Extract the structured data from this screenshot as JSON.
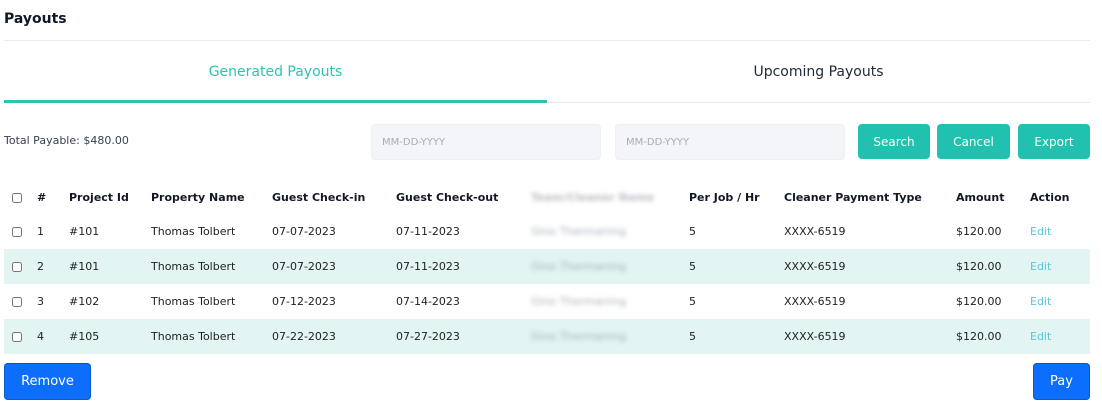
{
  "page": {
    "title": "Payouts"
  },
  "tabs": [
    {
      "label": "Generated Payouts",
      "active": true
    },
    {
      "label": "Upcoming Payouts",
      "active": false
    }
  ],
  "filters": {
    "total_payable": "Total Payable: $480.00",
    "start_date_placeholder": "MM-DD-YYYY",
    "end_date_placeholder": "MM-DD-YYYY",
    "search_label": "Search",
    "cancel_label": "Cancel",
    "export_label": "Export"
  },
  "table": {
    "headers": [
      "#",
      "Project Id",
      "Property Name",
      "Guest Check-in",
      "Guest Check-out",
      "Team/Cleaner Name",
      "Per Job / Hr",
      "Cleaner Payment Type",
      "Amount",
      "Action"
    ],
    "rows": [
      {
        "num": "1",
        "project_id": "#101",
        "property": "Thomas Tolbert",
        "checkin": "07-07-2023",
        "checkout": "07-11-2023",
        "team": "Gino Thermaning",
        "per_job": "5",
        "payment_type": "XXXX-6519",
        "amount": "$120.00",
        "action": "Edit"
      },
      {
        "num": "2",
        "project_id": "#101",
        "property": "Thomas Tolbert",
        "checkin": "07-07-2023",
        "checkout": "07-11-2023",
        "team": "Gino Thermaning",
        "per_job": "5",
        "payment_type": "XXXX-6519",
        "amount": "$120.00",
        "action": "Edit"
      },
      {
        "num": "3",
        "project_id": "#102",
        "property": "Thomas Tolbert",
        "checkin": "07-12-2023",
        "checkout": "07-14-2023",
        "team": "Gino Thermaning",
        "per_job": "5",
        "payment_type": "XXXX-6519",
        "amount": "$120.00",
        "action": "Edit"
      },
      {
        "num": "4",
        "project_id": "#105",
        "property": "Thomas Tolbert",
        "checkin": "07-22-2023",
        "checkout": "07-27-2023",
        "team": "Gino Thermaning",
        "per_job": "5",
        "payment_type": "XXXX-6519",
        "amount": "$120.00",
        "action": "Edit"
      }
    ]
  },
  "footer": {
    "remove_label": "Remove",
    "pay_label": "Pay"
  },
  "colors": {
    "accent": "#20c1ae",
    "primary": "#0d6efd",
    "row_alt": "#e2f5f2",
    "link": "#58c7d6"
  }
}
